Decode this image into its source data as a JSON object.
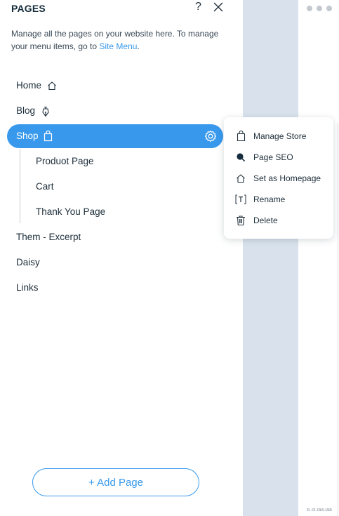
{
  "panel": {
    "title": "PAGES",
    "help_label": "?",
    "description_prefix": "Manage all the pages on your website here. To manage your menu items, go to ",
    "description_link": "Site Menu",
    "description_suffix": "."
  },
  "pages": [
    {
      "label": "Home",
      "icon": "home-icon"
    },
    {
      "label": "Blog",
      "icon": "pen-icon"
    },
    {
      "label": "Shop",
      "icon": "shopping-bag-icon",
      "selected": true
    },
    {
      "label": "Produot Page",
      "icon": ""
    },
    {
      "label": "Cart",
      "icon": ""
    },
    {
      "label": "Thank You Page",
      "icon": ""
    },
    {
      "label": "Them - Excerpt",
      "icon": ""
    },
    {
      "label": "Daisy",
      "icon": ""
    },
    {
      "label": "Links",
      "icon": ""
    }
  ],
  "context_menu": {
    "items": [
      {
        "label": "Manage Store",
        "icon": "shopping-bag-icon"
      },
      {
        "label": "Page SEO",
        "icon": "search-icon"
      },
      {
        "label": "Set as Homepage",
        "icon": "home-icon"
      },
      {
        "label": "Rename",
        "icon": "text-icon"
      },
      {
        "label": "Delete",
        "icon": "trash-icon"
      }
    ]
  },
  "footer": {
    "add_page_label": "+ Add Page"
  },
  "corner_text": "ɛı.ıx.ıaa.ıaa",
  "colors": {
    "accent": "#3899ec",
    "canvas": "#d9e2ec",
    "text": "#20303c"
  }
}
